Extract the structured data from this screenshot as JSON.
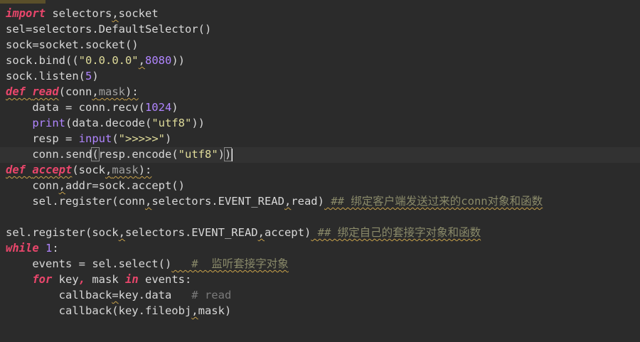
{
  "lines": [
    [
      "import",
      " selectors",
      ",",
      "socket"
    ],
    [
      "sel=selectors.DefaultSelector()"
    ],
    [
      "sock=socket.socket()"
    ],
    [
      "sock.bind((",
      "\"0.0.0.0\"",
      ",",
      "8080",
      "))"
    ],
    [
      "sock.listen(",
      "5",
      ")"
    ],
    [
      "def",
      " ",
      "read",
      "(conn",
      ",",
      "mask",
      "):"
    ],
    [
      "    ",
      "data = conn.recv(",
      "1024",
      ")"
    ],
    [
      "    ",
      "print",
      "(data.decode(",
      "\"utf8\"",
      "))"
    ],
    [
      "    ",
      "resp = ",
      "input",
      "(",
      "\">>>>>\"",
      ")"
    ],
    [
      "    ",
      "conn.send",
      "(",
      "resp.encode(",
      "\"utf8\"",
      ")",
      ")"
    ],
    [
      "def",
      " ",
      "accept",
      "(sock",
      ",",
      "mask",
      "):"
    ],
    [
      "    ",
      "conn",
      ",",
      "addr",
      "=sock.accept()"
    ],
    [
      "    ",
      "sel.register(conn",
      ",",
      "selectors.EVENT_READ",
      ",",
      "read)",
      " ## 绑定客户端发送过来的conn对象和函数"
    ],
    [
      ""
    ],
    [
      "sel.register(sock",
      ",",
      "selectors.EVENT_READ",
      ",",
      "accept)",
      " ## 绑定自己的套接字对象和函数"
    ],
    [
      "while",
      " ",
      "1",
      ":"
    ],
    [
      "    ",
      "events = sel.select()",
      "   #  监听套接字对象"
    ],
    [
      "    ",
      "for",
      " key",
      ",",
      " mask ",
      "in",
      " events:"
    ],
    [
      "        ",
      "callback",
      "=",
      "key.data",
      "   # read"
    ],
    [
      "        ",
      "callback(key.fileobj",
      ",",
      "mask)"
    ]
  ],
  "theme": {
    "background": "#2b2b2b",
    "keyword": "#e8466b",
    "string": "#e0dc9a",
    "number": "#b085ff",
    "text": "#d8d8d8",
    "comment": "#8a8a6a",
    "warning_underline": "#c8a24a"
  }
}
